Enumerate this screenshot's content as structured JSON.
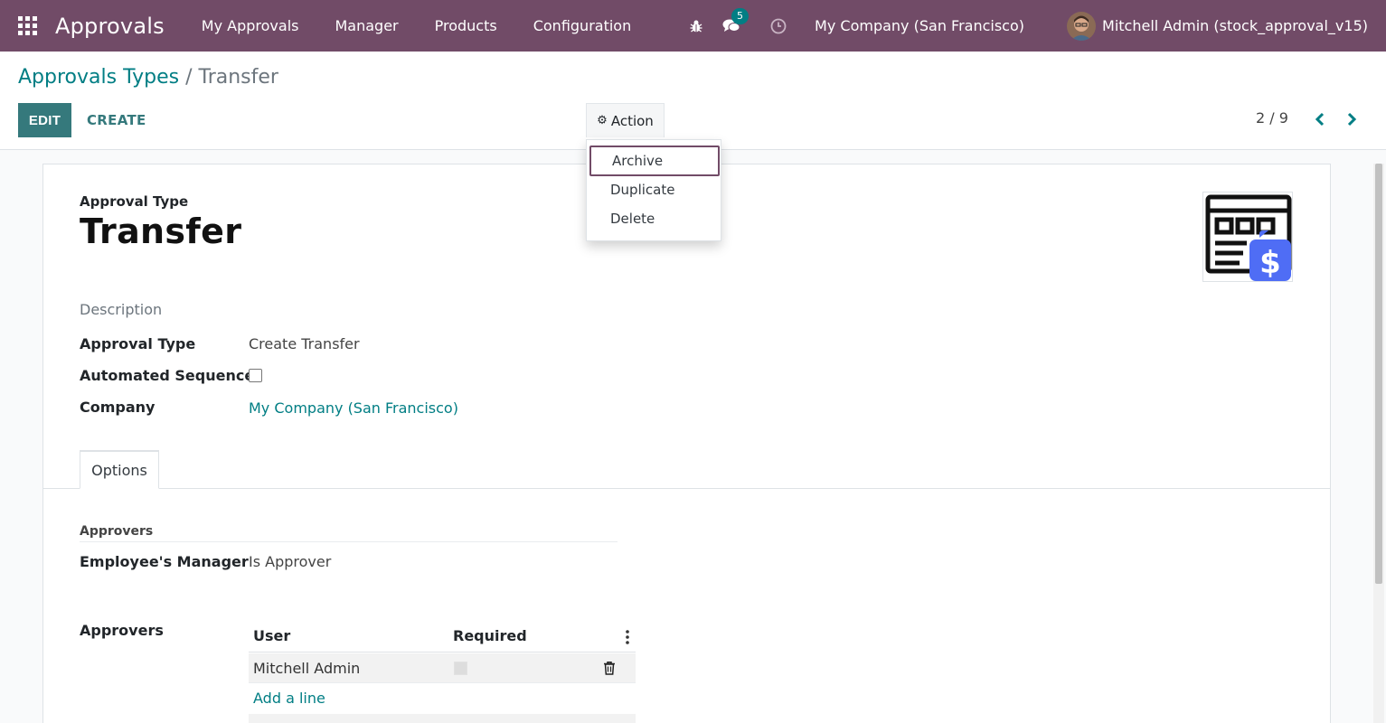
{
  "navbar": {
    "app_name": "Approvals",
    "menu": [
      "My Approvals",
      "Manager",
      "Products",
      "Configuration"
    ],
    "messages_count": "5",
    "company": "My Company (San Francisco)",
    "user": "Mitchell Admin (stock_approval_v15)",
    "color": "#714B67"
  },
  "breadcrumb": {
    "parent": "Approvals Types",
    "separator": "/",
    "current": "Transfer"
  },
  "toolbar": {
    "edit_label": "EDIT",
    "create_label": "CREATE",
    "action_label": "Action",
    "pager": "2 / 9"
  },
  "action_menu": {
    "items": [
      "Archive",
      "Duplicate",
      "Delete"
    ],
    "focused": "Archive"
  },
  "form": {
    "type_caption": "Approval Type",
    "name": "Transfer",
    "description_label": "Description",
    "fields": {
      "approval_type_label": "Approval Type",
      "approval_type_value": "Create Transfer",
      "automated_sequence_label": "Automated Sequence?",
      "automated_sequence_checked": false,
      "company_label": "Company",
      "company_value": "My Company (San Francisco)"
    },
    "tab_label": "Options",
    "approvers_group_title": "Approvers",
    "employee_manager_label": "Employee's Manager",
    "employee_manager_value": "Is Approver",
    "approvers_label": "Approvers",
    "approvers_table": {
      "columns": [
        "User",
        "Required"
      ],
      "rows": [
        {
          "user": "Mitchell Admin",
          "required": false
        }
      ],
      "add_line": "Add a line"
    }
  },
  "colors": {
    "accent": "#017e84",
    "button": "#35797c",
    "image_blue": "#4f6df5"
  }
}
